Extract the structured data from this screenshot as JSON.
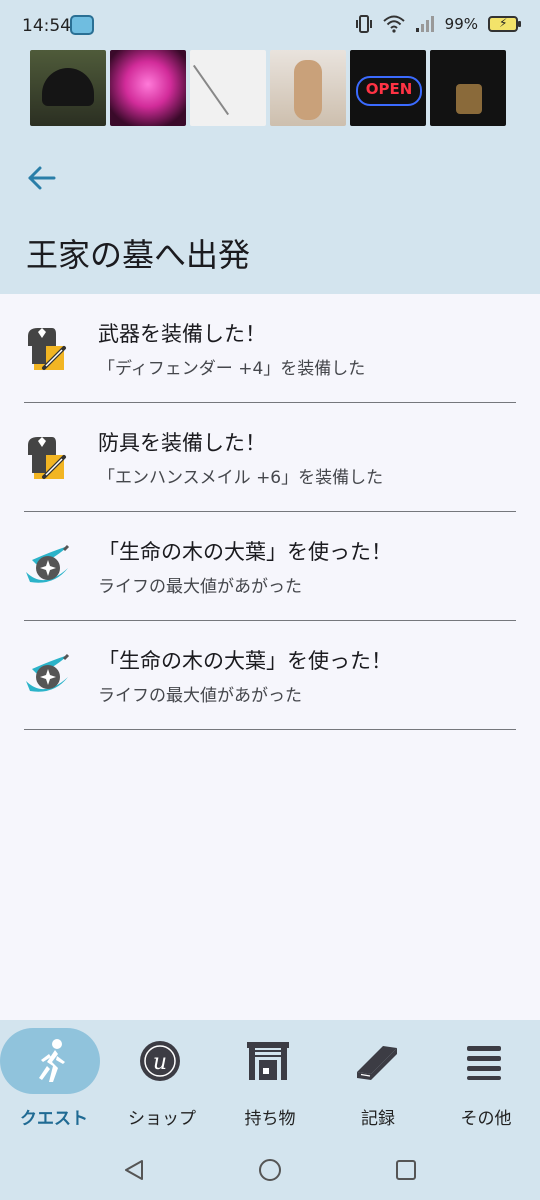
{
  "status_bar": {
    "time": "14:54",
    "battery_percent": "99%",
    "icons": [
      "app-notification-icon",
      "vibrate-icon",
      "wifi-icon",
      "signal-icon",
      "battery-charging-icon"
    ]
  },
  "ad_banner": {
    "thumbnails": [
      "black-cap",
      "pink-neon-cat-sign",
      "diagram-sheet",
      "wooden-mannequin",
      "open-neon-sign",
      "black-tshirt"
    ]
  },
  "header": {
    "back_icon": "arrow-left-icon",
    "title": "王家の墓へ出発"
  },
  "log": [
    {
      "icon": "weapon-equip-icon",
      "title": "武器を装備した！",
      "subtitle": "「ディフェンダー +4」を装備した"
    },
    {
      "icon": "armor-equip-icon",
      "title": "防具を装備した！",
      "subtitle": "「エンハンスメイル +6」を装備した"
    },
    {
      "icon": "item-use-icon",
      "title": "「生命の木の大葉」を使った！",
      "subtitle": "ライフの最大値があがった"
    },
    {
      "icon": "item-use-icon",
      "title": "「生命の木の大葉」を使った！",
      "subtitle": "ライフの最大値があがった"
    }
  ],
  "bottom_nav": {
    "items": [
      {
        "label": "クエスト",
        "icon": "running-person-icon",
        "active": true
      },
      {
        "label": "ショップ",
        "icon": "coin-icon",
        "active": false
      },
      {
        "label": "持ち物",
        "icon": "storehouse-icon",
        "active": false
      },
      {
        "label": "記録",
        "icon": "book-icon",
        "active": false
      },
      {
        "label": "その他",
        "icon": "menu-icon",
        "active": false
      }
    ]
  },
  "colors": {
    "header_bg": "#d3e4ee",
    "content_bg": "#f6f6fc",
    "accent": "#1f6a93",
    "active_pill": "#90c3dc",
    "divider": "#75777c"
  }
}
